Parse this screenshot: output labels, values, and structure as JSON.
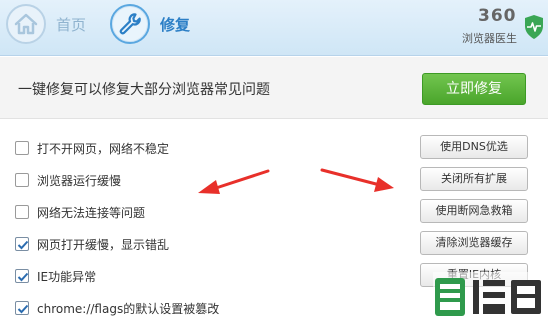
{
  "header": {
    "tabs": [
      {
        "label": "首页",
        "icon": "home-icon",
        "active": false
      },
      {
        "label": "修复",
        "icon": "wrench-icon",
        "active": true
      }
    ],
    "brand": {
      "number": "360",
      "name": "浏览器医生",
      "logo_icon": "shield-heartbeat-icon"
    }
  },
  "banner": {
    "text": "一键修复可以修复大部分浏览器常见问题",
    "button_label": "立即修复"
  },
  "issues": [
    {
      "label": "打不开网页，网络不稳定",
      "checked": false,
      "button": "使用DNS优选"
    },
    {
      "label": "浏览器运行缓慢",
      "checked": false,
      "button": "关闭所有扩展"
    },
    {
      "label": "网络无法连接等问题",
      "checked": false,
      "button": "使用断网急救箱"
    },
    {
      "label": "网页打开缓慢，显示错乱",
      "checked": true,
      "button": "清除浏览器缓存"
    },
    {
      "label": "IE功能异常",
      "checked": true,
      "button": "重置IE内核"
    },
    {
      "label": "chrome://flags的默认设置被篡改",
      "checked": true,
      "button": ""
    }
  ],
  "colors": {
    "accent_blue": "#2c7fc6",
    "repair_green": "#4aa52b",
    "annotation_red": "#e8302a",
    "checkbox_check": "#2b6cb0"
  },
  "watermark": {
    "icon": "site-watermark-icon"
  }
}
